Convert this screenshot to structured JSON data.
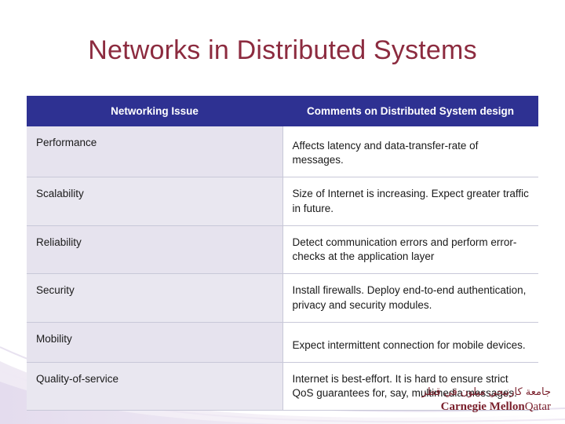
{
  "slide": {
    "title": "Networks in Distributed Systems",
    "accent_color": "#8c2b3f",
    "header_color": "#2e3192",
    "row_label_color": "#e6e3ee"
  },
  "table": {
    "headers": [
      "Networking Issue",
      "Comments on Distributed System design"
    ],
    "rows": [
      {
        "issue": "Performance",
        "comment": "Affects latency and data-transfer-rate of messages."
      },
      {
        "issue": "Scalability",
        "comment": "Size of Internet is increasing. Expect greater traffic in future."
      },
      {
        "issue": "Reliability",
        "comment": "Detect communication errors and perform error-checks at the application layer"
      },
      {
        "issue": "Security",
        "comment": "Install firewalls. Deploy end-to-end authentication, privacy and security modules."
      },
      {
        "issue": "Mobility",
        "comment": "Expect intermittent connection for mobile devices."
      },
      {
        "issue": "Quality-of-service",
        "comment": "Internet is best-effort. It is hard to ensure strict QoS guarantees for, say, multimedia messages."
      }
    ]
  },
  "logo": {
    "arabic": "جامعة كارنيجي ميلون في قطر",
    "latin_main": "Carnegie Mellon",
    "latin_sub": "Qatar"
  }
}
